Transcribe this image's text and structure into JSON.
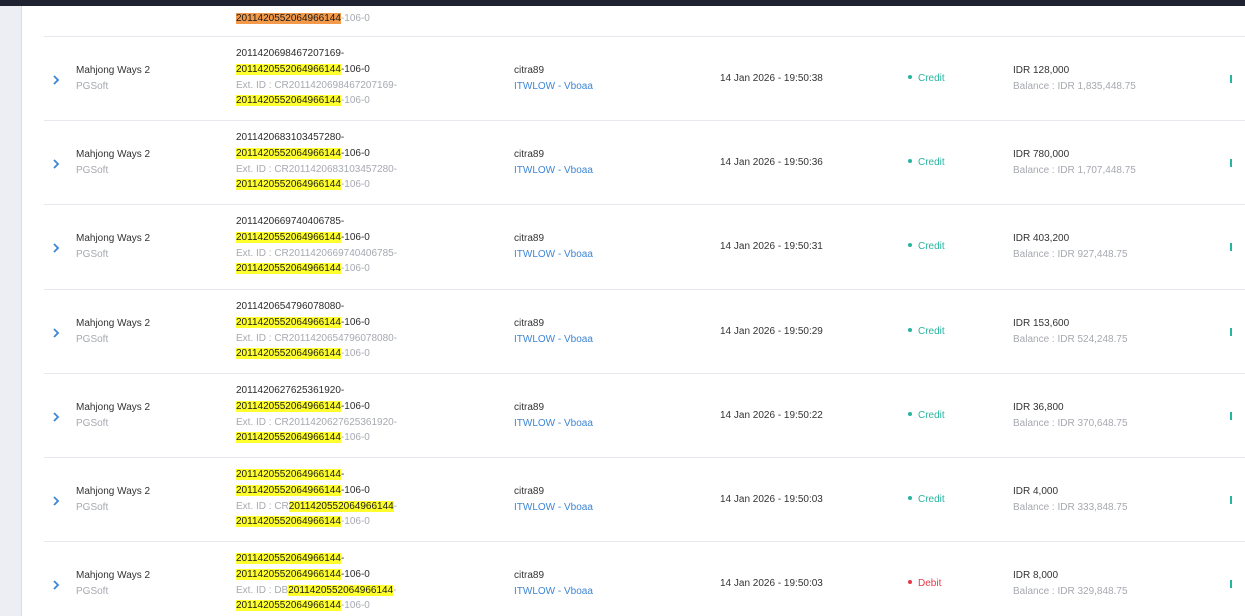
{
  "accent_credit": "#27b5a0",
  "accent_debit": "#e53946",
  "link_color": "#3d86d6",
  "search_highlight": "2011420552064966144",
  "top_partial": {
    "tx_line": "2011420552064966144",
    "tx_suffix": "-106-0"
  },
  "rows": [
    {
      "game": "Mahjong Ways 2",
      "provider": "PGSoft",
      "tx_pre": "2011420698467207169-",
      "tx_hl": "2011420552064966144",
      "tx_post": "-106-0",
      "ext_pre": "Ext. ID : CR2011420698467207169-",
      "ext_hl": "2011420552064966144",
      "ext_post": "-106-0",
      "user": "citra89",
      "agent": "ITWLOW - Vboaa",
      "date": "14 Jan 2026 - 19:50:38",
      "status": "Credit",
      "amount": "IDR 128,000",
      "balance": "Balance : IDR 1,835,448.75"
    },
    {
      "game": "Mahjong Ways 2",
      "provider": "PGSoft",
      "tx_pre": "2011420683103457280-",
      "tx_hl": "2011420552064966144",
      "tx_post": "-106-0",
      "ext_pre": "Ext. ID : CR2011420683103457280-",
      "ext_hl": "2011420552064966144",
      "ext_post": "-106-0",
      "user": "citra89",
      "agent": "ITWLOW - Vboaa",
      "date": "14 Jan 2026 - 19:50:36",
      "status": "Credit",
      "amount": "IDR 780,000",
      "balance": "Balance : IDR 1,707,448.75"
    },
    {
      "game": "Mahjong Ways 2",
      "provider": "PGSoft",
      "tx_pre": "2011420669740406785-",
      "tx_hl": "2011420552064966144",
      "tx_post": "-106-0",
      "ext_pre": "Ext. ID : CR2011420669740406785-",
      "ext_hl": "2011420552064966144",
      "ext_post": "-106-0",
      "user": "citra89",
      "agent": "ITWLOW - Vboaa",
      "date": "14 Jan 2026 - 19:50:31",
      "status": "Credit",
      "amount": "IDR 403,200",
      "balance": "Balance : IDR 927,448.75"
    },
    {
      "game": "Mahjong Ways 2",
      "provider": "PGSoft",
      "tx_pre": "2011420654796078080-",
      "tx_hl": "2011420552064966144",
      "tx_post": "-106-0",
      "ext_pre": "Ext. ID : CR2011420654796078080-",
      "ext_hl": "2011420552064966144",
      "ext_post": "-106-0",
      "user": "citra89",
      "agent": "ITWLOW - Vboaa",
      "date": "14 Jan 2026 - 19:50:29",
      "status": "Credit",
      "amount": "IDR 153,600",
      "balance": "Balance : IDR 524,248.75"
    },
    {
      "game": "Mahjong Ways 2",
      "provider": "PGSoft",
      "tx_pre": "2011420627625361920-",
      "tx_hl": "2011420552064966144",
      "tx_post": "-106-0",
      "ext_pre": "Ext. ID : CR2011420627625361920-",
      "ext_hl": "2011420552064966144",
      "ext_post": "-106-0",
      "user": "citra89",
      "agent": "ITWLOW - Vboaa",
      "date": "14 Jan 2026 - 19:50:22",
      "status": "Credit",
      "amount": "IDR 36,800",
      "balance": "Balance : IDR 370,648.75"
    },
    {
      "game": "Mahjong Ways 2",
      "provider": "PGSoft",
      "tx_line1_hl": "2011420552064966144",
      "tx_line1_post": "-",
      "tx_line2_hl": "2011420552064966144",
      "tx_line2_post": "-106-0",
      "ext_pre": "Ext. ID : CR",
      "ext_hl": "2011420552064966144",
      "ext_post": "-",
      "ext2_hl": "2011420552064966144",
      "ext2_post": "-106-0",
      "user": "citra89",
      "agent": "ITWLOW - Vboaa",
      "date": "14 Jan 2026 - 19:50:03",
      "status": "Credit",
      "amount": "IDR 4,000",
      "balance": "Balance : IDR 333,848.75"
    },
    {
      "game": "Mahjong Ways 2",
      "provider": "PGSoft",
      "tx_line1_hl": "2011420552064966144",
      "tx_line1_post": "-",
      "tx_line2_hl": "2011420552064966144",
      "tx_line2_post": "-106-0",
      "ext_pre": "Ext. ID : DB",
      "ext_hl": "2011420552064966144",
      "ext_post": "-",
      "ext2_hl": "2011420552064966144",
      "ext2_post": "-106-0",
      "user": "citra89",
      "agent": "ITWLOW - Vboaa",
      "date": "14 Jan 2026 - 19:50:03",
      "status": "Debit",
      "amount": "IDR 8,000",
      "balance": "Balance : IDR 329,848.75"
    }
  ]
}
